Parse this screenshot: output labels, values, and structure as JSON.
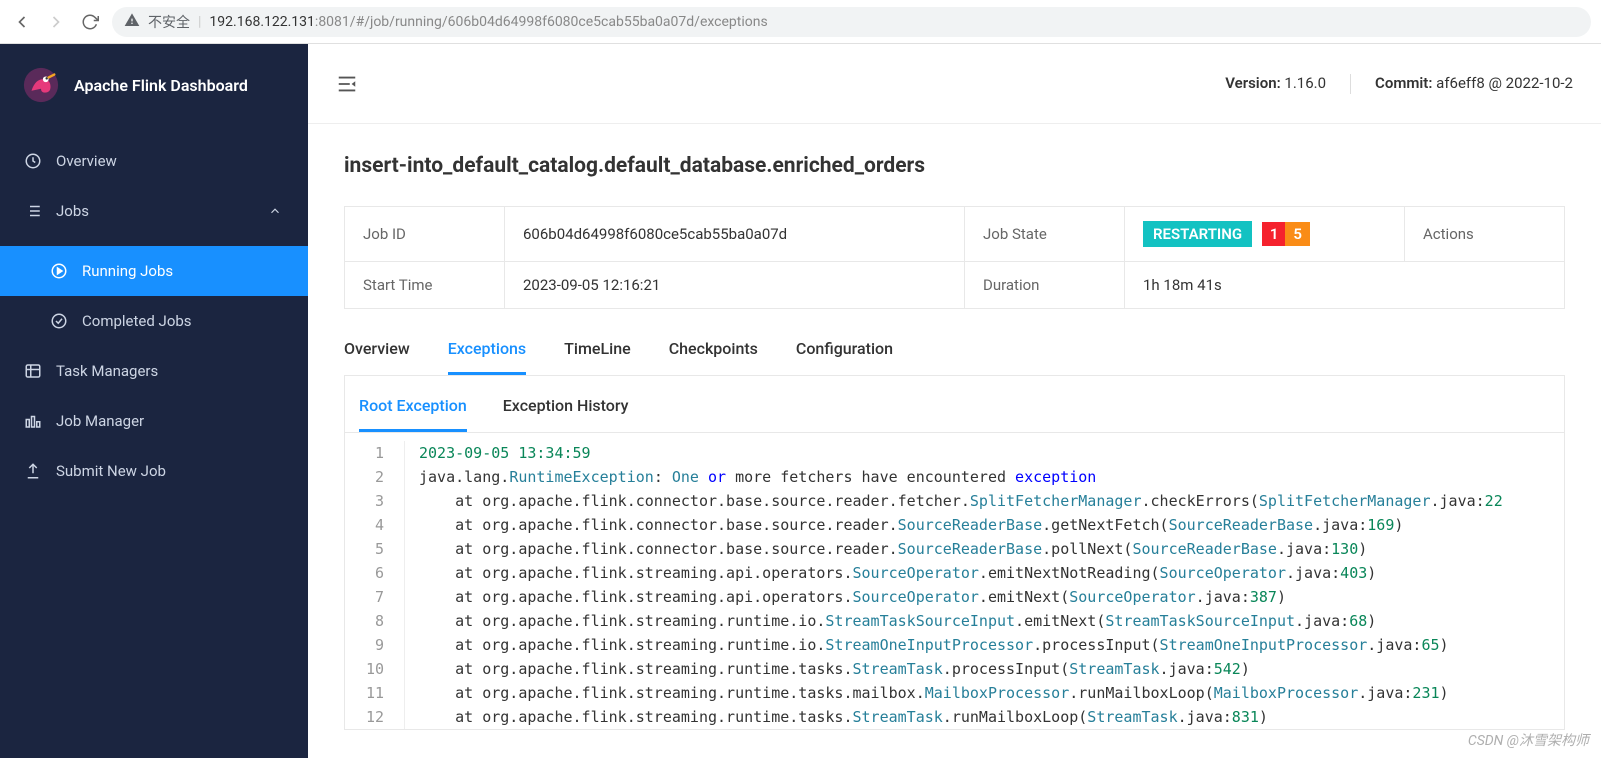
{
  "browser": {
    "insecure_label": "不安全",
    "host": "192.168.122.131",
    "port": ":8081",
    "path": "/#/job/running/606b04d64998f6080ce5cab55ba0a07d/exceptions"
  },
  "sidebar": {
    "title": "Apache Flink Dashboard",
    "items": {
      "overview": "Overview",
      "jobs": "Jobs",
      "running_jobs": "Running Jobs",
      "completed_jobs": "Completed Jobs",
      "task_managers": "Task Managers",
      "job_manager": "Job Manager",
      "submit_new_job": "Submit New Job"
    }
  },
  "header": {
    "version_label": "Version:",
    "version_value": "1.16.0",
    "commit_label": "Commit:",
    "commit_value": "af6eff8 @ 2022-10-2"
  },
  "job": {
    "title": "insert-into_default_catalog.default_database.enriched_orders",
    "labels": {
      "job_id": "Job ID",
      "job_state": "Job State",
      "actions": "Actions",
      "start_time": "Start Time",
      "duration": "Duration"
    },
    "job_id": "606b04d64998f6080ce5cab55ba0a07d",
    "state": "RESTARTING",
    "badge1": "1",
    "badge2": "5",
    "start_time": "2023-09-05 12:16:21",
    "duration": "1h 18m 41s"
  },
  "tabs": {
    "overview": "Overview",
    "exceptions": "Exceptions",
    "timeline": "TimeLine",
    "checkpoints": "Checkpoints",
    "configuration": "Configuration"
  },
  "subtabs": {
    "root": "Root Exception",
    "history": "Exception History"
  },
  "exception": {
    "lines": [
      {
        "n": 1,
        "segs": [
          {
            "t": "2023-09-05 13:34:59",
            "c": "tok-ts"
          }
        ]
      },
      {
        "n": 2,
        "segs": [
          {
            "t": "java.lang.",
            "c": ""
          },
          {
            "t": "RuntimeException",
            "c": "tok-type"
          },
          {
            "t": ": ",
            "c": ""
          },
          {
            "t": "One",
            "c": "tok-type"
          },
          {
            "t": " ",
            "c": ""
          },
          {
            "t": "or",
            "c": "tok-kw"
          },
          {
            "t": " more fetchers have encountered ",
            "c": ""
          },
          {
            "t": "exception",
            "c": "tok-kw"
          }
        ]
      },
      {
        "n": 3,
        "segs": [
          {
            "t": "    at org.apache.flink.connector.base.source.reader.fetcher.",
            "c": ""
          },
          {
            "t": "SplitFetcherManager",
            "c": "tok-type"
          },
          {
            "t": ".checkErrors(",
            "c": ""
          },
          {
            "t": "SplitFetcherManager",
            "c": "tok-type"
          },
          {
            "t": ".java:",
            "c": ""
          },
          {
            "t": "22",
            "c": "tok-num"
          }
        ]
      },
      {
        "n": 4,
        "segs": [
          {
            "t": "    at org.apache.flink.connector.base.source.reader.",
            "c": ""
          },
          {
            "t": "SourceReaderBase",
            "c": "tok-type"
          },
          {
            "t": ".getNextFetch(",
            "c": ""
          },
          {
            "t": "SourceReaderBase",
            "c": "tok-type"
          },
          {
            "t": ".java:",
            "c": ""
          },
          {
            "t": "169",
            "c": "tok-num"
          },
          {
            "t": ")",
            "c": ""
          }
        ]
      },
      {
        "n": 5,
        "segs": [
          {
            "t": "    at org.apache.flink.connector.base.source.reader.",
            "c": ""
          },
          {
            "t": "SourceReaderBase",
            "c": "tok-type"
          },
          {
            "t": ".pollNext(",
            "c": ""
          },
          {
            "t": "SourceReaderBase",
            "c": "tok-type"
          },
          {
            "t": ".java:",
            "c": ""
          },
          {
            "t": "130",
            "c": "tok-num"
          },
          {
            "t": ")",
            "c": ""
          }
        ]
      },
      {
        "n": 6,
        "segs": [
          {
            "t": "    at org.apache.flink.streaming.api.operators.",
            "c": ""
          },
          {
            "t": "SourceOperator",
            "c": "tok-type"
          },
          {
            "t": ".emitNextNotReading(",
            "c": ""
          },
          {
            "t": "SourceOperator",
            "c": "tok-type"
          },
          {
            "t": ".java:",
            "c": ""
          },
          {
            "t": "403",
            "c": "tok-num"
          },
          {
            "t": ")",
            "c": ""
          }
        ]
      },
      {
        "n": 7,
        "segs": [
          {
            "t": "    at org.apache.flink.streaming.api.operators.",
            "c": ""
          },
          {
            "t": "SourceOperator",
            "c": "tok-type"
          },
          {
            "t": ".emitNext(",
            "c": ""
          },
          {
            "t": "SourceOperator",
            "c": "tok-type"
          },
          {
            "t": ".java:",
            "c": ""
          },
          {
            "t": "387",
            "c": "tok-num"
          },
          {
            "t": ")",
            "c": ""
          }
        ]
      },
      {
        "n": 8,
        "segs": [
          {
            "t": "    at org.apache.flink.streaming.runtime.io.",
            "c": ""
          },
          {
            "t": "StreamTaskSourceInput",
            "c": "tok-type"
          },
          {
            "t": ".emitNext(",
            "c": ""
          },
          {
            "t": "StreamTaskSourceInput",
            "c": "tok-type"
          },
          {
            "t": ".java:",
            "c": ""
          },
          {
            "t": "68",
            "c": "tok-num"
          },
          {
            "t": ")",
            "c": ""
          }
        ]
      },
      {
        "n": 9,
        "segs": [
          {
            "t": "    at org.apache.flink.streaming.runtime.io.",
            "c": ""
          },
          {
            "t": "StreamOneInputProcessor",
            "c": "tok-type"
          },
          {
            "t": ".processInput(",
            "c": ""
          },
          {
            "t": "StreamOneInputProcessor",
            "c": "tok-type"
          },
          {
            "t": ".java:",
            "c": ""
          },
          {
            "t": "65",
            "c": "tok-num"
          },
          {
            "t": ")",
            "c": ""
          }
        ]
      },
      {
        "n": 10,
        "segs": [
          {
            "t": "    at org.apache.flink.streaming.runtime.tasks.",
            "c": ""
          },
          {
            "t": "StreamTask",
            "c": "tok-type"
          },
          {
            "t": ".processInput(",
            "c": ""
          },
          {
            "t": "StreamTask",
            "c": "tok-type"
          },
          {
            "t": ".java:",
            "c": ""
          },
          {
            "t": "542",
            "c": "tok-num"
          },
          {
            "t": ")",
            "c": ""
          }
        ]
      },
      {
        "n": 11,
        "segs": [
          {
            "t": "    at org.apache.flink.streaming.runtime.tasks.mailbox.",
            "c": ""
          },
          {
            "t": "MailboxProcessor",
            "c": "tok-type"
          },
          {
            "t": ".runMailboxLoop(",
            "c": ""
          },
          {
            "t": "MailboxProcessor",
            "c": "tok-type"
          },
          {
            "t": ".java:",
            "c": ""
          },
          {
            "t": "231",
            "c": "tok-num"
          },
          {
            "t": ")",
            "c": ""
          }
        ]
      },
      {
        "n": 12,
        "segs": [
          {
            "t": "    at org.apache.flink.streaming.runtime.tasks.",
            "c": ""
          },
          {
            "t": "StreamTask",
            "c": "tok-type"
          },
          {
            "t": ".runMailboxLoop(",
            "c": ""
          },
          {
            "t": "StreamTask",
            "c": "tok-type"
          },
          {
            "t": ".java:",
            "c": ""
          },
          {
            "t": "831",
            "c": "tok-num"
          },
          {
            "t": ")",
            "c": ""
          }
        ]
      }
    ]
  },
  "watermark": "CSDN @沐雪架构师"
}
